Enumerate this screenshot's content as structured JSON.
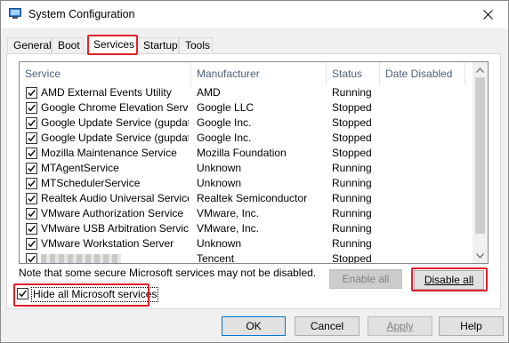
{
  "window": {
    "title": "System Configuration"
  },
  "tabs": [
    {
      "label": "General"
    },
    {
      "label": "Boot"
    },
    {
      "label": "Services"
    },
    {
      "label": "Startup"
    },
    {
      "label": "Tools"
    }
  ],
  "list": {
    "columns": [
      "Service",
      "Manufacturer",
      "Status",
      "Date Disabled"
    ],
    "rows": [
      {
        "service": "AMD External Events Utility",
        "manufacturer": "AMD",
        "status": "Running",
        "checked": true
      },
      {
        "service": "Google Chrome Elevation Servic...",
        "manufacturer": "Google LLC",
        "status": "Stopped",
        "checked": true
      },
      {
        "service": "Google Update Service (gupdate)",
        "manufacturer": "Google Inc.",
        "status": "Stopped",
        "checked": true
      },
      {
        "service": "Google Update Service (gupdatem)",
        "manufacturer": "Google Inc.",
        "status": "Stopped",
        "checked": true
      },
      {
        "service": "Mozilla Maintenance Service",
        "manufacturer": "Mozilla Foundation",
        "status": "Stopped",
        "checked": true
      },
      {
        "service": "MTAgentService",
        "manufacturer": "Unknown",
        "status": "Running",
        "checked": true
      },
      {
        "service": "MTSchedulerService",
        "manufacturer": "Unknown",
        "status": "Running",
        "checked": true
      },
      {
        "service": "Realtek Audio Universal Service",
        "manufacturer": "Realtek Semiconductor",
        "status": "Running",
        "checked": true
      },
      {
        "service": "VMware Authorization Service",
        "manufacturer": "VMware, Inc.",
        "status": "Running",
        "checked": true
      },
      {
        "service": "VMware USB Arbitration Service",
        "manufacturer": "VMware, Inc.",
        "status": "Running",
        "checked": true
      },
      {
        "service": "VMware Workstation Server",
        "manufacturer": "Unknown",
        "status": "Running",
        "checked": true
      },
      {
        "service": "",
        "manufacturer": "Tencent",
        "status": "Stopped",
        "checked": true
      }
    ]
  },
  "note": "Note that some secure Microsoft services may not be disabled.",
  "buttons": {
    "enable_all": "Enable all",
    "disable_all": "Disable all",
    "ok": "OK",
    "cancel": "Cancel",
    "apply": "Apply",
    "help": "Help"
  },
  "hide_ms": {
    "label": "Hide all Microsoft services",
    "checked": true
  },
  "colors": {
    "highlight": "#e0202a",
    "header_text": "#4c607a",
    "focus_border": "#0078d7"
  }
}
